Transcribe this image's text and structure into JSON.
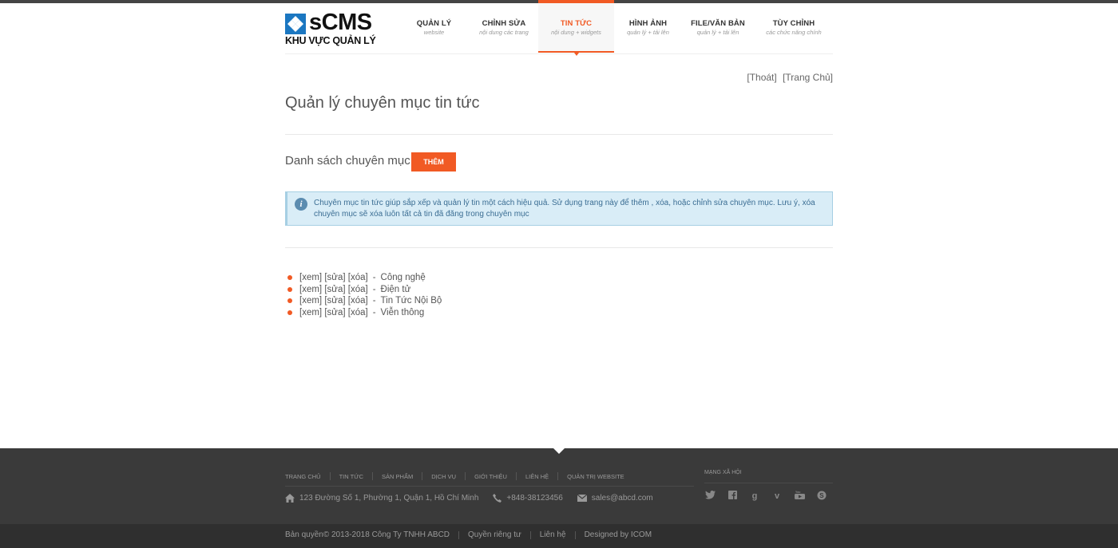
{
  "brand": {
    "logo_text": "sCMS",
    "logo_sub": "KHU VỰC QUẢN LÝ"
  },
  "nav": [
    {
      "title": "QUẢN LÝ",
      "sub": "website",
      "active": false
    },
    {
      "title": "CHỈNH SỬA",
      "sub": "nội dung các trang",
      "active": false
    },
    {
      "title": "TIN TỨC",
      "sub": "nội dung + widgets",
      "active": true
    },
    {
      "title": "HÌNH ẢNH",
      "sub": "quản lý + tải lên",
      "active": false
    },
    {
      "title": "FILE/VĂN BẢN",
      "sub": "quản lý + tải lên",
      "active": false
    },
    {
      "title": "TÙY CHỈNH",
      "sub": "các chức năng chính",
      "active": false
    }
  ],
  "toplinks": {
    "logout": "[Thoát]",
    "home": "[Trang Chủ]"
  },
  "page": {
    "title": "Quản lý chuyên mục tin tức",
    "section_title": "Danh sách chuyên mục",
    "add_button": "THÊM",
    "info_text": "Chuyên mục tin tức giúp sắp xếp và quản lý tin một cách hiệu quả. Sử dụng trang này để thêm , xóa, hoặc chỉnh sửa chuyên mục. Lưu ý, xóa chuyên mục sẽ xóa luôn tất cả tin đã đăng trong chuyên mục"
  },
  "actions": {
    "view": "[xem]",
    "edit": "[sửa]",
    "delete": "[xóa]",
    "separator": "-"
  },
  "categories": [
    "Công nghệ",
    "Điện tử",
    "Tin Tức Nội Bộ",
    "Viễn thông"
  ],
  "footer": {
    "nav": [
      "TRANG CHỦ",
      "TIN TỨC",
      "SẢN PHẨM",
      "DỊCH VỤ",
      "GIỚI THIỆU",
      "LIÊN HỆ",
      "QUẢN TRỊ WEBSITE"
    ],
    "address": "123 Đường Số 1, Phường 1, Quận 1, Hồ Chí Minh",
    "phone": "+848-38123456",
    "email": "sales@abcd.com",
    "social_title": "MẠNG XÃ HỘI",
    "social": [
      "twitter-icon",
      "facebook-icon",
      "google-plus-icon",
      "vimeo-icon",
      "youtube-icon",
      "skype-icon"
    ],
    "copyright": "Bản quyền© 2013-2018 Công Ty TNHH ABCD",
    "privacy": "Quyền riêng tư",
    "contact": "Liên hệ",
    "designed": "Designed by ICOM"
  },
  "colors": {
    "accent": "#f15a24",
    "info_bg": "#d9edf7",
    "footer_bg": "#3a3a3a"
  }
}
